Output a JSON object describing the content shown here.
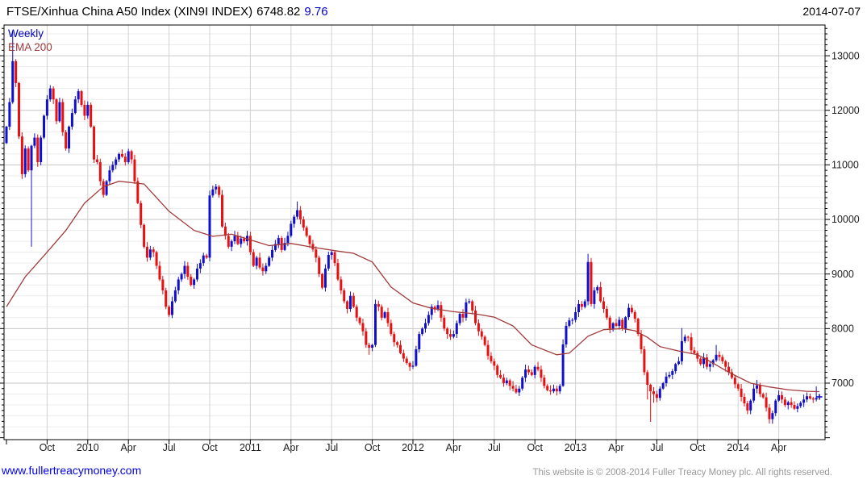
{
  "header": {
    "title": "FTSE/Xinhua China A50 Index (XIN9I INDEX)",
    "price": "6748.82",
    "change": "9.76",
    "date": "2014-07-07"
  },
  "legend": {
    "timeframe": "Weekly",
    "overlay": "EMA 200"
  },
  "footer": {
    "website": "www.fullertreacymoney.com",
    "copyright": "This website is © 2008-2014 Fuller Treacy Money plc. All rights reserved."
  },
  "chart_data": {
    "type": "candlestick",
    "timeframe": "Weekly",
    "title": "FTSE/Xinhua China A50 Index (XIN9I INDEX)",
    "last_price": 6748.82,
    "change": 9.76,
    "overlay": "EMA 200",
    "grid": "on",
    "y_axis": {
      "min": 5965,
      "max": 13563,
      "major_ticks": [
        7000,
        8000,
        9000,
        10000,
        11000,
        12000,
        13000
      ],
      "minor_grid_step": 200,
      "minor_tick_step": 100,
      "labels_side": "right"
    },
    "x_axis": {
      "start": "2009-07",
      "end": "2014-07",
      "labels": [
        {
          "label": "",
          "week": 0
        },
        {
          "label": "Oct",
          "week": 13
        },
        {
          "label": "2010",
          "week": 26
        },
        {
          "label": "Apr",
          "week": 39
        },
        {
          "label": "Jul",
          "week": 52
        },
        {
          "label": "Oct",
          "week": 65
        },
        {
          "label": "2011",
          "week": 78
        },
        {
          "label": "Apr",
          "week": 91
        },
        {
          "label": "Jul",
          "week": 104
        },
        {
          "label": "Oct",
          "week": 117
        },
        {
          "label": "2012",
          "week": 130
        },
        {
          "label": "Apr",
          "week": 143
        },
        {
          "label": "Jul",
          "week": 156
        },
        {
          "label": "Oct",
          "week": 169
        },
        {
          "label": "2013",
          "week": 182
        },
        {
          "label": "Apr",
          "week": 195
        },
        {
          "label": "Jul",
          "week": 208
        },
        {
          "label": "Oct",
          "week": 221
        },
        {
          "label": "2014",
          "week": 234
        },
        {
          "label": "Apr",
          "week": 247
        }
      ]
    },
    "first_open": 11400,
    "weekly_closes": [
      11700,
      12150,
      12900,
      12500,
      11520,
      10830,
      11300,
      10900,
      11350,
      11500,
      11050,
      11500,
      11900,
      12200,
      12400,
      12200,
      11800,
      12150,
      11600,
      11300,
      11700,
      11950,
      12200,
      12350,
      12100,
      11900,
      12100,
      11700,
      11100,
      11050,
      10700,
      10450,
      10700,
      10900,
      11000,
      11100,
      11200,
      11150,
      11050,
      11250,
      11100,
      10700,
      10300,
      9900,
      9500,
      9300,
      9450,
      9400,
      9150,
      8900,
      8700,
      8400,
      8250,
      8500,
      8700,
      8900,
      9000,
      9150,
      8950,
      8800,
      8900,
      9100,
      9200,
      9340,
      9300,
      10440,
      10550,
      10600,
      10450,
      9870,
      9700,
      9500,
      9600,
      9700,
      9550,
      9650,
      9600,
      9700,
      9400,
      9150,
      9300,
      9120,
      9050,
      9150,
      9300,
      9440,
      9550,
      9660,
      9440,
      9570,
      9700,
      9920,
      10050,
      10170,
      10000,
      9850,
      9700,
      9550,
      9450,
      9300,
      9000,
      8750,
      9100,
      9350,
      9400,
      9200,
      8900,
      8700,
      8500,
      8360,
      8600,
      8400,
      8200,
      8100,
      7950,
      7700,
      7650,
      7700,
      8450,
      8400,
      8200,
      8300,
      8100,
      7900,
      7750,
      7700,
      7550,
      7450,
      7370,
      7300,
      7320,
      7620,
      7900,
      8000,
      8100,
      8250,
      8400,
      8350,
      8430,
      8200,
      8000,
      7900,
      7850,
      7900,
      8100,
      8270,
      8200,
      8480,
      8500,
      8330,
      8100,
      7950,
      7850,
      7700,
      7500,
      7400,
      7320,
      7150,
      7100,
      7000,
      7050,
      6950,
      6900,
      6830,
      6900,
      7100,
      7250,
      7200,
      7150,
      7300,
      7250,
      7100,
      6950,
      6870,
      6850,
      6900,
      6850,
      6950,
      7710,
      8050,
      8150,
      8160,
      8300,
      8450,
      8400,
      8500,
      9220,
      8450,
      8700,
      8760,
      8500,
      8360,
      8200,
      8000,
      8100,
      8050,
      8160,
      8000,
      8210,
      8380,
      8300,
      8180,
      7900,
      7620,
      7200,
      6970,
      6850,
      6800,
      6730,
      6900,
      7000,
      7120,
      7150,
      7220,
      7350,
      7400,
      7770,
      7850,
      7840,
      7600,
      7550,
      7450,
      7350,
      7470,
      7300,
      7350,
      7420,
      7520,
      7480,
      7400,
      7300,
      7200,
      7100,
      6980,
      6900,
      6750,
      6630,
      6500,
      6680,
      6900,
      6960,
      6800,
      6740,
      6550,
      6340,
      6450,
      6680,
      6780,
      6700,
      6600,
      6650,
      6600,
      6530,
      6580,
      6640,
      6700,
      6760,
      6720,
      6700,
      6730,
      6748.82
    ],
    "wick_overrides": {
      "2": {
        "high": 13440
      },
      "8": {
        "low": 9500
      },
      "52": {
        "low": 8210
      },
      "93": {
        "high": 10330
      },
      "116": {
        "low": 7520
      },
      "130": {
        "low": 7260
      },
      "186": {
        "high": 9370
      },
      "205": {
        "low": 6700
      },
      "206": {
        "low": 6290
      },
      "207": {
        "low": 6640
      },
      "216": {
        "high": 8010
      },
      "227": {
        "high": 7700
      },
      "237": {
        "low": 6430
      },
      "240": {
        "high": 7060
      },
      "244": {
        "low": 6260
      },
      "259": {
        "high": 6940
      }
    },
    "ema200_anchors": [
      [
        0,
        8400
      ],
      [
        6,
        8950
      ],
      [
        13,
        9400
      ],
      [
        19,
        9800
      ],
      [
        25,
        10300
      ],
      [
        31,
        10600
      ],
      [
        36,
        10700
      ],
      [
        44,
        10650
      ],
      [
        52,
        10150
      ],
      [
        60,
        9800
      ],
      [
        66,
        9690
      ],
      [
        72,
        9730
      ],
      [
        84,
        9520
      ],
      [
        91,
        9560
      ],
      [
        98,
        9490
      ],
      [
        106,
        9420
      ],
      [
        111,
        9380
      ],
      [
        117,
        9220
      ],
      [
        123,
        8760
      ],
      [
        130,
        8470
      ],
      [
        136,
        8370
      ],
      [
        143,
        8310
      ],
      [
        150,
        8270
      ],
      [
        156,
        8210
      ],
      [
        162,
        8050
      ],
      [
        168,
        7700
      ],
      [
        176,
        7520
      ],
      [
        180,
        7550
      ],
      [
        186,
        7860
      ],
      [
        191,
        7980
      ],
      [
        197,
        8000
      ],
      [
        201,
        7960
      ],
      [
        205,
        7840
      ],
      [
        209,
        7670
      ],
      [
        215,
        7590
      ],
      [
        221,
        7520
      ],
      [
        225,
        7400
      ],
      [
        231,
        7200
      ],
      [
        238,
        7000
      ],
      [
        244,
        6930
      ],
      [
        250,
        6880
      ],
      [
        256,
        6850
      ],
      [
        260,
        6845
      ]
    ],
    "last_point_marker": "plus",
    "colors": {
      "up": "#1010cc",
      "down": "#e81010",
      "ema": "#a23a3a",
      "grid_major": "#c6c6c6",
      "grid_minor": "#ececec",
      "grid_vertical": "#d2d2d2",
      "axis": "#000000",
      "label": "#1c1c1c",
      "change": "#0000cc",
      "link": "#0000e6",
      "copyright": "#999999"
    }
  }
}
